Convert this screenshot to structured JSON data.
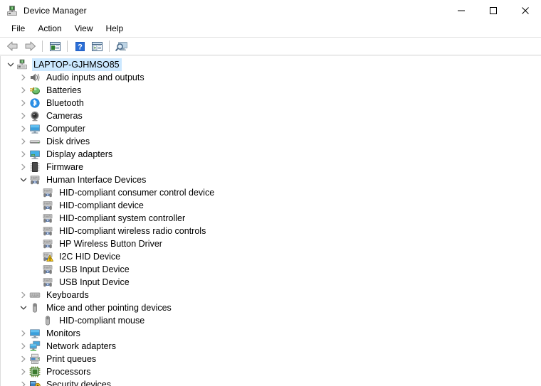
{
  "window": {
    "title": "Device Manager",
    "icon": "device-manager-icon",
    "controls": {
      "minimize": "minimize-icon",
      "maximize": "maximize-icon",
      "close": "close-icon"
    }
  },
  "menubar": {
    "items": [
      {
        "label": "File"
      },
      {
        "label": "Action"
      },
      {
        "label": "View"
      },
      {
        "label": "Help"
      }
    ]
  },
  "toolbar": {
    "buttons": [
      {
        "name": "back-button",
        "icon": "back-arrow-icon",
        "enabled": true
      },
      {
        "name": "forward-button",
        "icon": "forward-arrow-icon",
        "enabled": true
      },
      {
        "name": "separator-1",
        "icon": "separator",
        "enabled": false
      },
      {
        "name": "properties-button",
        "icon": "properties-window-icon",
        "enabled": true
      },
      {
        "name": "separator-2",
        "icon": "separator",
        "enabled": false
      },
      {
        "name": "help-button",
        "icon": "help-question-icon",
        "enabled": true
      },
      {
        "name": "update-driver-button",
        "icon": "window-play-icon",
        "enabled": true
      },
      {
        "name": "separator-3",
        "icon": "separator",
        "enabled": false
      },
      {
        "name": "scan-hardware-changes-button",
        "icon": "monitor-scan-icon",
        "enabled": true
      }
    ]
  },
  "tree": {
    "nodes": [
      {
        "label": "LAPTOP-GJHMSO85",
        "depth": 0,
        "state": "expanded",
        "icon": "computer-node-icon",
        "selected": true
      },
      {
        "label": "Audio inputs and outputs",
        "depth": 1,
        "state": "collapsed",
        "icon": "speaker-icon",
        "selected": false
      },
      {
        "label": "Batteries",
        "depth": 1,
        "state": "collapsed",
        "icon": "battery-icon",
        "selected": false
      },
      {
        "label": "Bluetooth",
        "depth": 1,
        "state": "collapsed",
        "icon": "bluetooth-icon",
        "selected": false
      },
      {
        "label": "Cameras",
        "depth": 1,
        "state": "collapsed",
        "icon": "camera-icon",
        "selected": false
      },
      {
        "label": "Computer",
        "depth": 1,
        "state": "collapsed",
        "icon": "monitor-icon",
        "selected": false
      },
      {
        "label": "Disk drives",
        "depth": 1,
        "state": "collapsed",
        "icon": "disk-drive-icon",
        "selected": false
      },
      {
        "label": "Display adapters",
        "depth": 1,
        "state": "collapsed",
        "icon": "display-adapter-icon",
        "selected": false
      },
      {
        "label": "Firmware",
        "depth": 1,
        "state": "collapsed",
        "icon": "firmware-chip-icon",
        "selected": false
      },
      {
        "label": "Human Interface Devices",
        "depth": 1,
        "state": "expanded",
        "icon": "hid-icon",
        "selected": false
      },
      {
        "label": "HID-compliant consumer control device",
        "depth": 2,
        "state": "leaf",
        "icon": "hid-icon",
        "selected": false
      },
      {
        "label": "HID-compliant device",
        "depth": 2,
        "state": "leaf",
        "icon": "hid-icon",
        "selected": false
      },
      {
        "label": "HID-compliant system controller",
        "depth": 2,
        "state": "leaf",
        "icon": "hid-icon",
        "selected": false
      },
      {
        "label": "HID-compliant wireless radio controls",
        "depth": 2,
        "state": "leaf",
        "icon": "hid-icon",
        "selected": false
      },
      {
        "label": "HP Wireless Button Driver",
        "depth": 2,
        "state": "leaf",
        "icon": "hid-icon",
        "selected": false
      },
      {
        "label": "I2C HID Device",
        "depth": 2,
        "state": "leaf",
        "icon": "hid-warning-icon",
        "selected": false,
        "warning": true
      },
      {
        "label": "USB Input Device",
        "depth": 2,
        "state": "leaf",
        "icon": "hid-icon",
        "selected": false
      },
      {
        "label": "USB Input Device",
        "depth": 2,
        "state": "leaf",
        "icon": "hid-icon",
        "selected": false
      },
      {
        "label": "Keyboards",
        "depth": 1,
        "state": "collapsed",
        "icon": "keyboard-icon",
        "selected": false
      },
      {
        "label": "Mice and other pointing devices",
        "depth": 1,
        "state": "expanded",
        "icon": "mouse-icon",
        "selected": false
      },
      {
        "label": "HID-compliant mouse",
        "depth": 2,
        "state": "leaf",
        "icon": "mouse-icon",
        "selected": false
      },
      {
        "label": "Monitors",
        "depth": 1,
        "state": "collapsed",
        "icon": "monitor-icon",
        "selected": false
      },
      {
        "label": "Network adapters",
        "depth": 1,
        "state": "collapsed",
        "icon": "network-adapter-icon",
        "selected": false
      },
      {
        "label": "Print queues",
        "depth": 1,
        "state": "collapsed",
        "icon": "printer-icon",
        "selected": false
      },
      {
        "label": "Processors",
        "depth": 1,
        "state": "collapsed",
        "icon": "processor-chip-icon",
        "selected": false
      },
      {
        "label": "Security devices",
        "depth": 1,
        "state": "collapsed",
        "icon": "security-device-icon",
        "selected": false
      }
    ]
  },
  "colors": {
    "selection": "#cce8ff",
    "warning": "#ffd000",
    "accent_blue": "#2a6ebb",
    "window_bg": "#ffffff"
  }
}
